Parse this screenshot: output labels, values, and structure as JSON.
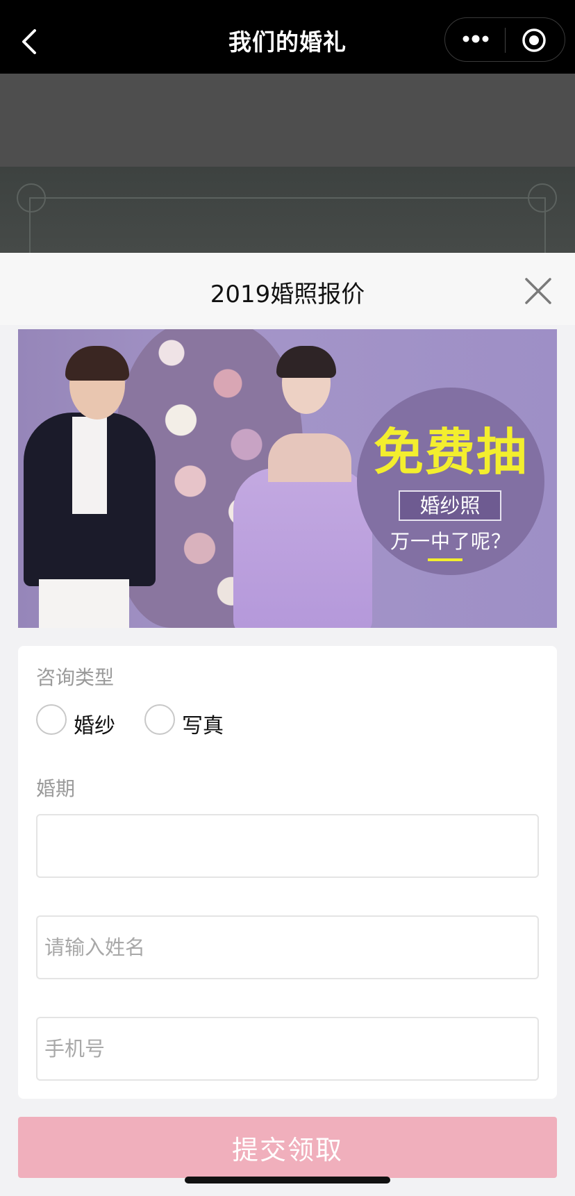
{
  "navbar": {
    "title": "我们的婚礼",
    "back_icon": "chevron-left-icon",
    "more_icon": "more-dots-icon",
    "close_icon": "target-circle-icon",
    "background": "#000000"
  },
  "modal": {
    "title": "2019婚照报价",
    "close_icon": "close-icon"
  },
  "banner": {
    "headline": "免费抽",
    "tag": "婚纱照",
    "subline": "万一中了呢？",
    "accent": "#f3ee2e"
  },
  "form": {
    "type_label": "咨询类型",
    "options": [
      {
        "label": "婚纱"
      },
      {
        "label": "写真"
      }
    ],
    "date_label": "婚期",
    "date_value": "",
    "name_placeholder": "请输入姓名",
    "phone_placeholder": "手机号"
  },
  "submit": {
    "label": "提交领取",
    "color": "#f0afbc"
  }
}
